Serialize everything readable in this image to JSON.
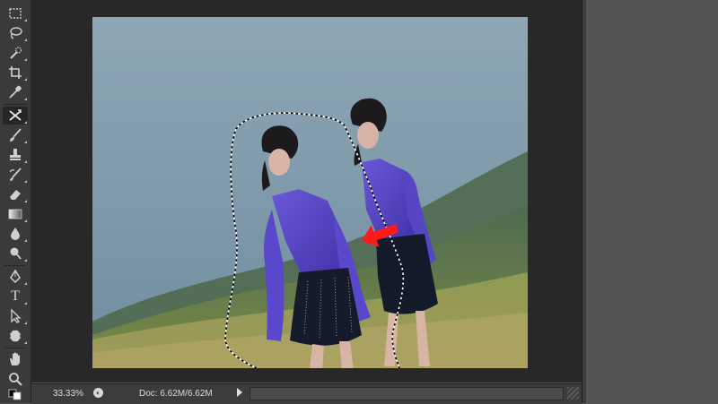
{
  "toolbar": {
    "tools": [
      {
        "name": "marquee-tool",
        "icon": "rect-marquee-icon"
      },
      {
        "name": "lasso-tool",
        "icon": "lasso-icon"
      },
      {
        "name": "quick-selection-tool",
        "icon": "quick-select-icon"
      },
      {
        "name": "crop-tool",
        "icon": "crop-icon"
      },
      {
        "name": "eyedropper-tool",
        "icon": "eyedropper-icon"
      },
      {
        "name": "content-aware-move-tool",
        "icon": "content-aware-move-icon",
        "active": true
      },
      {
        "name": "brush-tool",
        "icon": "brush-icon"
      },
      {
        "name": "clone-stamp-tool",
        "icon": "stamp-icon"
      },
      {
        "name": "history-brush-tool",
        "icon": "history-brush-icon"
      },
      {
        "name": "eraser-tool",
        "icon": "eraser-icon"
      },
      {
        "name": "gradient-tool",
        "icon": "gradient-icon"
      },
      {
        "name": "blur-tool",
        "icon": "blur-drop-icon"
      },
      {
        "name": "dodge-tool",
        "icon": "dodge-icon"
      },
      {
        "name": "pen-tool",
        "icon": "pen-icon"
      },
      {
        "name": "type-tool",
        "icon": "type-icon"
      },
      {
        "name": "path-selection-tool",
        "icon": "path-select-arrow-icon"
      },
      {
        "name": "shape-tool",
        "icon": "custom-shape-icon"
      },
      {
        "name": "hand-tool",
        "icon": "hand-icon"
      },
      {
        "name": "zoom-tool",
        "icon": "zoom-icon"
      }
    ],
    "type_glyph": "T"
  },
  "statusbar": {
    "zoom": "33.33%",
    "doc_info": "Doc: 6.62M/6.62M"
  },
  "colors": {
    "workspace": "#282828",
    "panel": "#535353",
    "toolbar": "#3a3a3a",
    "selection_marching_ants": "#ffffff",
    "arrow_annotation": "#ff1a1a",
    "dress_purple": "#5a48c8",
    "sky": "#7b98a8"
  }
}
